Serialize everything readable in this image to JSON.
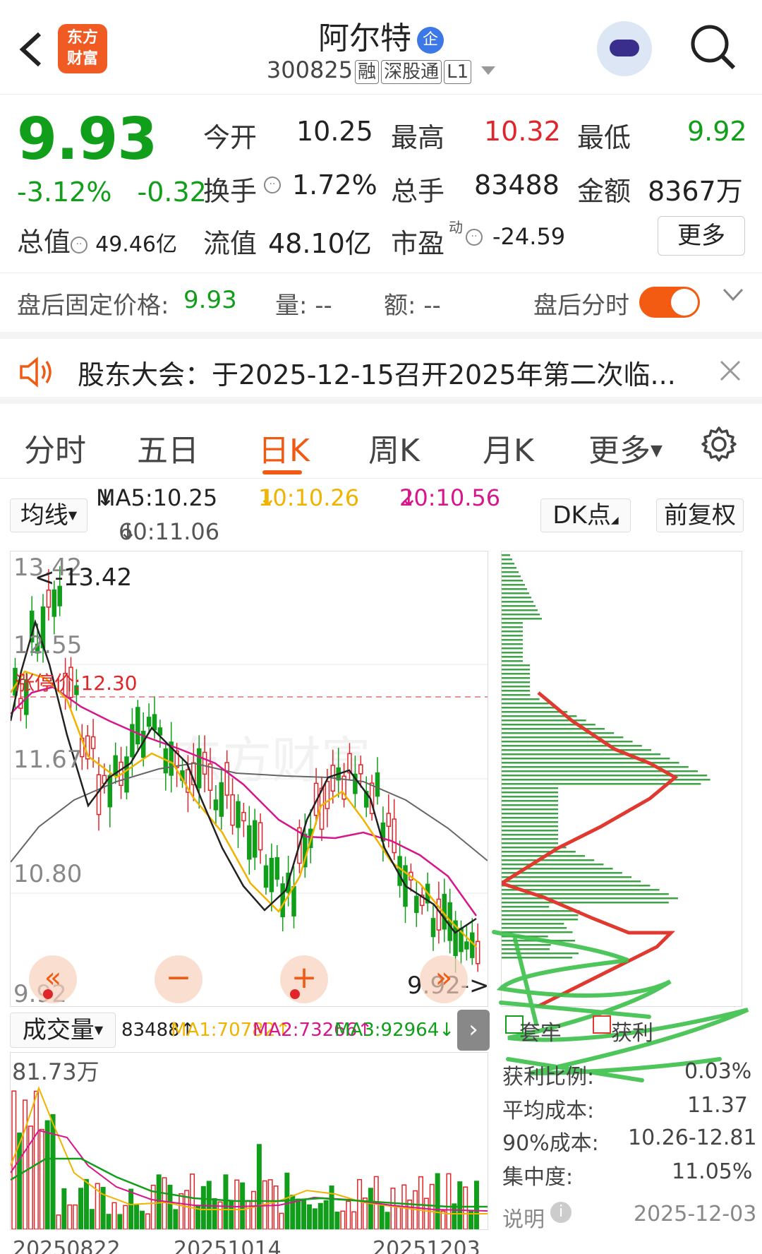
{
  "header": {
    "logo_text_1": "东方",
    "logo_text_2": "财富",
    "stock_name": "阿尔特",
    "badge": "企",
    "code": "300825",
    "tags": [
      "融",
      "深股通",
      "L1"
    ]
  },
  "quote": {
    "price": "9.93",
    "change_pct": "-3.12%",
    "change_amt": "-0.32",
    "open_label": "今开",
    "open": "10.25",
    "high_label": "最高",
    "high": "10.32",
    "low_label": "最低",
    "low": "9.92",
    "turnover_label": "换手",
    "turnover": "1.72%",
    "volume_label": "总手",
    "volume": "83488",
    "amount_label": "金额",
    "amount": "8367万",
    "mcap_label": "总值",
    "mcap": "49.46亿",
    "float_label": "流值",
    "float": "48.10亿",
    "pe_label": "市盈",
    "pe_sup": "动",
    "pe": "-24.59",
    "more": "更多"
  },
  "after_hours": {
    "fixed_label": "盘后固定价格:",
    "fixed_value": "9.93",
    "vol": "量: --",
    "amt": "额: --",
    "toggle_label": "盘后分时"
  },
  "notice": {
    "text": "股东大会：于2025-12-15召开2025年第二次临..."
  },
  "tabs": [
    "分时",
    "五日",
    "日K",
    "周K",
    "月K",
    "更多"
  ],
  "ma": {
    "selector": "均线",
    "ma5": "MA5:10.25",
    "ma10": "10:10.26",
    "ma20": "20:10.56",
    "ma60": "60:11.06",
    "dk": "DK点",
    "fq": "前复权",
    "colors": {
      "ma5": "#222222",
      "ma10": "#f0b400",
      "ma20": "#d6178c",
      "ma60": "#666666"
    }
  },
  "kline": {
    "y_labels": [
      "13.42",
      "12.55",
      "11.67",
      "10.80",
      "9.92"
    ],
    "high_marker": "<-13.42",
    "low_marker": "9.92->",
    "limit_label": "涨停价:12.30"
  },
  "volume": {
    "selector": "成交量",
    "current": "83488",
    "ma1": "MA1:70782",
    "ma2": "MA2:73266",
    "ma3": "MA3:92964",
    "max_label": "81.73万",
    "dates": [
      "20250822",
      "20251014",
      "20251203"
    ]
  },
  "chips": {
    "legend_trapped": "套牢",
    "legend_profit": "获利",
    "profit_ratio_label": "获利比例:",
    "profit_ratio": "0.03%",
    "avg_cost_label": "平均成本:",
    "avg_cost": "11.37",
    "cost90_label": "90%成本:",
    "cost90": "10.26-12.81",
    "concentration_label": "集中度:",
    "concentration": "11.05%",
    "explain": "说明",
    "date": "2025-12-03"
  }
}
